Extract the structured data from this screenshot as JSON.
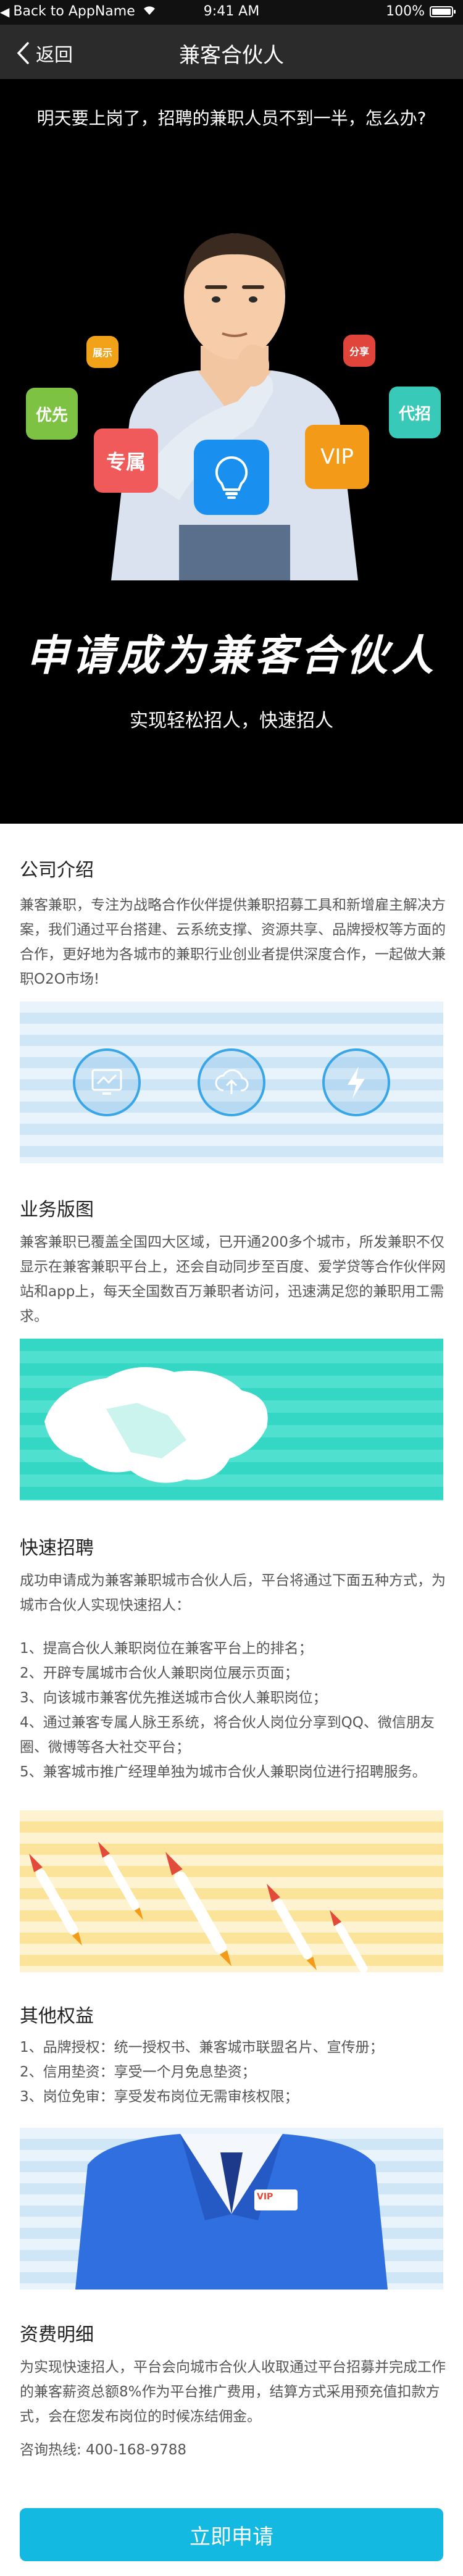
{
  "status": {
    "back_app": "Back to AppName",
    "time": "9:41 AM",
    "battery": "100%"
  },
  "nav": {
    "back_label": "返回",
    "title": "兼客合伙人"
  },
  "hero": {
    "question": "明天要上岗了，招聘的兼职人员不到一半，怎么办?",
    "badges": {
      "youxian": "优先",
      "zhanshi": "展示",
      "zhuanshu": "专属",
      "vip": "VIP",
      "fenxiang": "分享",
      "daizhao": "代招"
    },
    "headline": "申请成为兼客合伙人",
    "subtitle": "实现轻松招人，快速招人"
  },
  "sections": {
    "intro": {
      "title": "公司介绍",
      "body": "兼客兼职，专注为战略合作伙伴提供兼职招募工具和新增雇主解决方案，我们通过平台搭建、云系统支撑、资源共享、品牌授权等方面的合作，更好地为各城市的兼职行业创业者提供深度合作，一起做大兼职O2O市场!"
    },
    "map": {
      "title": "业务版图",
      "body": "兼客兼职已覆盖全国四大区域，已开通200多个城市，所发兼职不仅显示在兼客兼职平台上，还会自动同步至百度、爱学贷等合作伙伴网站和app上，每天全国数百万兼职者访问，迅速满足您的兼职用工需求。"
    },
    "fast": {
      "title": "快速招聘",
      "body": "成功申请成为兼客兼职城市合伙人后，平台将通过下面五种方式，为城市合伙人实现快速招人：",
      "items": [
        "1、提高合伙人兼职岗位在兼客平台上的排名；",
        "2、开辟专属城市合伙人兼职岗位展示页面；",
        "3、向该城市兼客优先推送城市合伙人兼职岗位；",
        "4、通过兼客专属人脉王系统，将合伙人岗位分享到QQ、微信朋友圈、微博等各大社交平台；",
        "5、兼客城市推广经理单独为城市合伙人兼职岗位进行招聘服务。"
      ]
    },
    "rights": {
      "title": "其他权益",
      "items": [
        "1、品牌授权：统一授权书、兼客城市联盟名片、宣传册；",
        "2、信用垫资：享受一个月免息垫资；",
        "3、岗位免审：享受发布岗位无需审核权限；"
      ],
      "vip_tag": "VIP"
    },
    "fees": {
      "title": "资费明细",
      "body": "为实现快速招人，平台会向城市合伙人收取通过平台招募并完成工作的兼客薪资总额8%作为平台推广费用，结算方式采用预充值扣款方式，会在您发布岗位的时候冻结佣金。",
      "hotline": "咨询热线: 400-168-9788"
    }
  },
  "cta": {
    "apply_label": "立即申请"
  },
  "colors": {
    "accent": "#13b9e0",
    "nav_bg": "#2b2b2b",
    "hero_bg": "#000000",
    "map_teal": "#2fd3c0"
  }
}
